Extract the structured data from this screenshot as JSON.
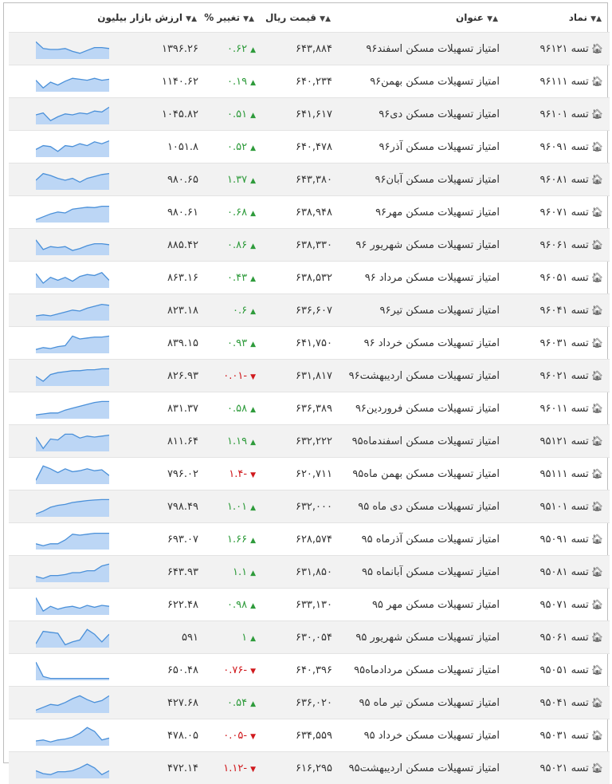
{
  "headers": {
    "symbol": "نماد",
    "title": "عنوان",
    "price": "قیمت ریال",
    "change": "تغییر %",
    "market": "ارزش بازار بیلیون"
  },
  "colors": {
    "up": "#2e9b3b",
    "down": "#d0191d",
    "spark_line": "#4a90d9",
    "spark_fill": "#bcd6f5"
  },
  "rows": [
    {
      "symbol": "تسه ۹۶۱۲۱",
      "title": "امتیاز تسهیلات مسکن اسفند۹۶",
      "price": "۶۴۳,۸۸۴",
      "change": "۰.۶۲",
      "dir": "up",
      "market": "۱۳۹۶.۲۶",
      "spark": [
        0.9,
        0.55,
        0.5,
        0.5,
        0.55,
        0.4,
        0.3,
        0.45,
        0.6,
        0.6,
        0.55
      ]
    },
    {
      "symbol": "تسه ۹۶۱۱۱",
      "title": "امتیاز تسهیلات مسکن بهمن۹۶",
      "price": "۶۴۰,۲۳۴",
      "change": "۰.۱۹",
      "dir": "up",
      "market": "۱۱۴۰.۶۲",
      "spark": [
        0.6,
        0.2,
        0.5,
        0.35,
        0.55,
        0.7,
        0.65,
        0.6,
        0.7,
        0.6,
        0.65
      ]
    },
    {
      "symbol": "تسه ۹۶۱۰۱",
      "title": "امتیاز تسهیلات مسکن دی۹۶",
      "price": "۶۴۱,۶۱۷",
      "change": "۰.۵۱",
      "dir": "up",
      "market": "۱۰۴۵.۸۲",
      "spark": [
        0.5,
        0.6,
        0.2,
        0.4,
        0.55,
        0.5,
        0.6,
        0.55,
        0.7,
        0.65,
        0.9
      ]
    },
    {
      "symbol": "تسه ۹۶۰۹۱",
      "title": "امتیاز تسهیلات مسکن آذر۹۶",
      "price": "۶۴۰,۴۷۸",
      "change": "۰.۵۲",
      "dir": "up",
      "market": "۱۰۵۱.۸",
      "spark": [
        0.4,
        0.6,
        0.55,
        0.3,
        0.6,
        0.55,
        0.7,
        0.6,
        0.8,
        0.7,
        0.85
      ]
    },
    {
      "symbol": "تسه ۹۶۰۸۱",
      "title": "امتیاز تسهیلات مسکن آبان۹۶",
      "price": "۶۴۳,۳۸۰",
      "change": "۱.۳۷",
      "dir": "up",
      "market": "۹۸۰.۶۵",
      "spark": [
        0.5,
        0.85,
        0.75,
        0.6,
        0.5,
        0.6,
        0.4,
        0.6,
        0.7,
        0.8,
        0.85
      ]
    },
    {
      "symbol": "تسه ۹۶۰۷۱",
      "title": "امتیاز تسهیلات مسکن مهر۹۶",
      "price": "۶۳۸,۹۴۸",
      "change": "۰.۶۸",
      "dir": "up",
      "market": "۹۸۰.۶۱",
      "spark": [
        0.15,
        0.3,
        0.45,
        0.55,
        0.5,
        0.7,
        0.75,
        0.8,
        0.78,
        0.85,
        0.85
      ]
    },
    {
      "symbol": "تسه ۹۶۰۶۱",
      "title": "امتیاز تسهیلات مسکن شهریور ۹۶",
      "price": "۶۳۸,۳۳۰",
      "change": "۰.۸۶",
      "dir": "up",
      "market": "۸۸۵.۴۲",
      "spark": [
        0.8,
        0.3,
        0.45,
        0.4,
        0.45,
        0.25,
        0.35,
        0.5,
        0.6,
        0.6,
        0.55
      ]
    },
    {
      "symbol": "تسه ۹۶۰۵۱",
      "title": "امتیاز تسهیلات مسکن مرداد ۹۶",
      "price": "۶۳۸,۵۳۲",
      "change": "۰.۴۳",
      "dir": "up",
      "market": "۸۶۳.۱۶",
      "spark": [
        0.75,
        0.25,
        0.55,
        0.4,
        0.55,
        0.35,
        0.6,
        0.7,
        0.65,
        0.8,
        0.4
      ]
    },
    {
      "symbol": "تسه ۹۶۰۴۱",
      "title": "امتیاز تسهیلات مسکن تیر۹۶",
      "price": "۶۳۶,۶۰۷",
      "change": "۰.۶",
      "dir": "up",
      "market": "۸۲۳.۱۸",
      "spark": [
        0.25,
        0.3,
        0.25,
        0.35,
        0.45,
        0.55,
        0.5,
        0.65,
        0.75,
        0.85,
        0.8
      ]
    },
    {
      "symbol": "تسه ۹۶۰۳۱",
      "title": "امتیاز تسهیلات مسکن خرداد ۹۶",
      "price": "۶۴۱,۷۵۰",
      "change": "۰.۹۳",
      "dir": "up",
      "market": "۸۳۹.۱۵",
      "spark": [
        0.2,
        0.3,
        0.25,
        0.35,
        0.4,
        0.9,
        0.75,
        0.8,
        0.85,
        0.85,
        0.9
      ]
    },
    {
      "symbol": "تسه ۹۶۰۲۱",
      "title": "امتیاز تسهیلات مسکن اردیبهشت۹۶",
      "price": "۶۳۱,۸۱۷",
      "change": "-۰.۰۱",
      "dir": "down",
      "market": "۸۲۶.۹۳",
      "spark": [
        0.5,
        0.25,
        0.6,
        0.7,
        0.75,
        0.8,
        0.8,
        0.85,
        0.85,
        0.9,
        0.9
      ]
    },
    {
      "symbol": "تسه ۹۶۰۱۱",
      "title": "امتیاز تسهیلات مسکن فروردین۹۶",
      "price": "۶۳۶,۳۸۹",
      "change": "۰.۵۸",
      "dir": "up",
      "market": "۸۳۱.۳۷",
      "spark": [
        0.2,
        0.25,
        0.3,
        0.3,
        0.45,
        0.55,
        0.65,
        0.75,
        0.85,
        0.9,
        0.9
      ]
    },
    {
      "symbol": "تسه ۹۵۱۲۱",
      "title": "امتیاز تسهیلات مسکن اسفندماه۹۵",
      "price": "۶۳۲,۲۲۲",
      "change": "۱.۱۹",
      "dir": "up",
      "market": "۸۱۱.۶۴",
      "spark": [
        0.75,
        0.15,
        0.65,
        0.6,
        0.9,
        0.9,
        0.7,
        0.8,
        0.75,
        0.8,
        0.85
      ]
    },
    {
      "symbol": "تسه ۹۵۱۱۱",
      "title": "امتیاز تسهیلات مسکن بهمن ماه۹۵",
      "price": "۶۲۰,۷۱۱",
      "change": "-۱.۴",
      "dir": "down",
      "market": "۷۹۶.۰۲",
      "spark": [
        0.2,
        0.95,
        0.8,
        0.6,
        0.8,
        0.65,
        0.7,
        0.8,
        0.7,
        0.75,
        0.45
      ]
    },
    {
      "symbol": "تسه ۹۵۱۰۱",
      "title": "امتیاز تسهیلات مسکن دی ماه ۹۵",
      "price": "۶۳۲,۰۰۰",
      "change": "۱.۰۱",
      "dir": "up",
      "market": "۷۹۸.۴۹",
      "spark": [
        0.15,
        0.3,
        0.5,
        0.6,
        0.65,
        0.75,
        0.8,
        0.85,
        0.88,
        0.9,
        0.9
      ]
    },
    {
      "symbol": "تسه ۹۵۰۹۱",
      "title": "امتیاز تسهیلات مسکن آذرماه ۹۵",
      "price": "۶۲۸,۵۷۴",
      "change": "۱.۶۶",
      "dir": "up",
      "market": "۶۹۳.۰۷",
      "spark": [
        0.3,
        0.2,
        0.3,
        0.3,
        0.5,
        0.8,
        0.75,
        0.8,
        0.85,
        0.85,
        0.85
      ]
    },
    {
      "symbol": "تسه ۹۵۰۸۱",
      "title": "امتیاز تسهیلات مسکن آبانماه ۹۵",
      "price": "۶۳۱,۸۵۰",
      "change": "۱.۱",
      "dir": "up",
      "market": "۶۴۳.۹۳",
      "spark": [
        0.3,
        0.2,
        0.35,
        0.35,
        0.4,
        0.5,
        0.5,
        0.6,
        0.6,
        0.85,
        0.95
      ]
    },
    {
      "symbol": "تسه ۹۵۰۷۱",
      "title": "امتیاز تسهیلات مسکن مهر ۹۵",
      "price": "۶۳۳,۱۳۰",
      "change": "۰.۹۸",
      "dir": "up",
      "market": "۶۲۲.۴۸",
      "spark": [
        0.9,
        0.2,
        0.45,
        0.3,
        0.4,
        0.45,
        0.35,
        0.5,
        0.4,
        0.5,
        0.45
      ]
    },
    {
      "symbol": "تسه ۹۵۰۶۱",
      "title": "امتیاز تسهیلات مسکن شهریور ۹۵",
      "price": "۶۳۰,۰۵۴",
      "change": "۱",
      "dir": "up",
      "market": "۵۹۱",
      "spark": [
        0.2,
        0.85,
        0.8,
        0.75,
        0.15,
        0.3,
        0.4,
        0.95,
        0.7,
        0.3,
        0.7
      ]
    },
    {
      "symbol": "تسه ۹۵۰۵۱",
      "title": "امتیاز تسهیلات مسکن مردادماه۹۵",
      "price": "۶۴۰,۳۹۶",
      "change": "-۰.۷۶",
      "dir": "down",
      "market": "۶۵۰.۴۸",
      "spark": [
        0.95,
        0.2,
        0.1,
        0.1,
        0.1,
        0.1,
        0.1,
        0.1,
        0.1,
        0.1,
        0.1
      ]
    },
    {
      "symbol": "تسه ۹۵۰۴۱",
      "title": "امتیاز تسهیلات مسکن تیر ماه ۹۵",
      "price": "۶۳۶,۰۲۰",
      "change": "۰.۵۴",
      "dir": "up",
      "market": "۴۲۷.۶۸",
      "spark": [
        0.15,
        0.3,
        0.45,
        0.4,
        0.55,
        0.75,
        0.9,
        0.7,
        0.55,
        0.65,
        0.9
      ]
    },
    {
      "symbol": "تسه ۹۵۰۳۱",
      "title": "امتیاز تسهیلات مسکن خرداد ۹۵",
      "price": "۶۳۴,۵۵۹",
      "change": "-۰.۰۵",
      "dir": "down",
      "market": "۴۷۸.۰۵",
      "spark": [
        0.25,
        0.3,
        0.2,
        0.3,
        0.35,
        0.45,
        0.65,
        0.95,
        0.75,
        0.3,
        0.4
      ]
    },
    {
      "symbol": "تسه ۹۵۰۲۱",
      "title": "امتیاز تسهیلات مسکن اردیبهشت۹۵",
      "price": "۶۱۶,۲۹۵",
      "change": "-۱.۱۲",
      "dir": "down",
      "market": "۴۷۲.۱۴",
      "spark": [
        0.4,
        0.25,
        0.2,
        0.35,
        0.35,
        0.4,
        0.55,
        0.75,
        0.55,
        0.2,
        0.4
      ]
    }
  ]
}
